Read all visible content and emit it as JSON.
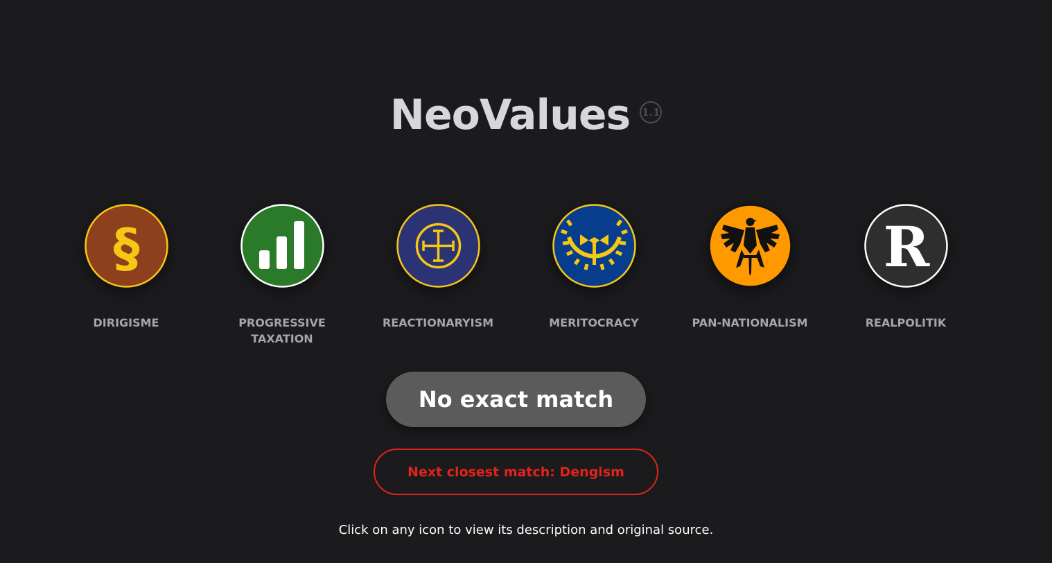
{
  "app": {
    "title": "NeoValues",
    "version": "1.1"
  },
  "results": [
    {
      "id": "dirigisme",
      "label": "DIRIGISME",
      "icon": "section-sign-icon",
      "bg": "#8e3f1e",
      "border": "#f6c815",
      "symbol_color": "#f6c815"
    },
    {
      "id": "progressive-taxation",
      "label": "PROGRESSIVE\nTAXATION",
      "icon": "bar-chart-icon",
      "bg": "#2a7a2a",
      "border": "#ffffff",
      "symbol_color": "#ffffff"
    },
    {
      "id": "reactionaryism",
      "label": "REACTIONARYISM",
      "icon": "cross-in-circle-icon",
      "bg": "#2b3375",
      "border": "#f6c815",
      "symbol_color": "#f6c815"
    },
    {
      "id": "meritocracy",
      "label": "MERITOCRACY",
      "icon": "gear-emblem-icon",
      "bg": "#073d8c",
      "border": "#f6c815",
      "symbol_color": "#f6c815"
    },
    {
      "id": "pan-nationalism",
      "label": "PAN-NATIONALISM",
      "icon": "eagle-sword-icon",
      "bg": "#ff9900",
      "border": "#111111",
      "symbol_color": "#111111"
    },
    {
      "id": "realpolitik",
      "label": "REALPOLITIK",
      "icon": "letter-r-icon",
      "bg": "#2e2e2e",
      "border": "#ffffff",
      "symbol_color": "#ffffff",
      "symbol_text": "R"
    }
  ],
  "match": {
    "label": "No exact match"
  },
  "next_match": {
    "label": "Next closest match: Dengism",
    "color": "#e0241b"
  },
  "hint": "Click on any icon to view its description and original source."
}
